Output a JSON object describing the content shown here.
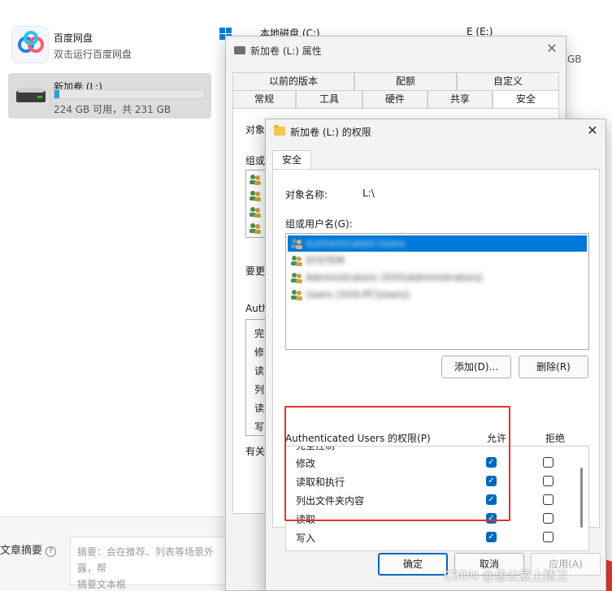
{
  "explorer": {
    "baidu": {
      "name": "百度网盘",
      "subtitle": "双击运行百度网盘"
    },
    "drive_l": {
      "name": "新加卷 (L:)",
      "space": "224 GB 可用，共 231 GB",
      "usage_fraction": 0.03
    },
    "drive_c": {
      "name": "本地磁盘 (C:)"
    },
    "drive_e": {
      "name": "E (E:)",
      "gb_partial": "GB"
    },
    "summary": {
      "label": "文章摘要",
      "help": "?",
      "placeholder_lines": [
        "摘要：会在推荐、列表等场景外露，帮",
        "摘要文本框"
      ]
    }
  },
  "properties_dialog": {
    "title": "新加卷 (L:) 属性",
    "tabs_row1": [
      "以前的版本",
      "配额",
      "自定义"
    ],
    "tabs_row2": [
      "常规",
      "工具",
      "硬件",
      "共享",
      "安全"
    ],
    "active_tab": "安全",
    "side_labels": [
      "对象:",
      "组或",
      "要更",
      "Auth",
      "完",
      "修",
      "读",
      "列",
      "读",
      "写",
      "有关"
    ]
  },
  "permissions_dialog": {
    "title": "新加卷 (L:) 的权限",
    "tab": "安全",
    "object_name_label": "对象名称:",
    "object_name_value": "L:\\",
    "group_label": "组或用户名(G):",
    "users": [
      {
        "name": "Authenticated Users",
        "selected": true
      },
      {
        "name": "SYSTEM",
        "selected": false
      },
      {
        "name": "Administrators (XXX\\Administrators)",
        "selected": false
      },
      {
        "name": "Users (XXX-PC\\Users)",
        "selected": false
      }
    ],
    "add_button": "添加(D)...",
    "remove_button": "删除(R)",
    "perm_header": "Authenticated Users 的权限(P)",
    "allow_header": "允许",
    "deny_header": "拒绝",
    "partial_row": "完全控制",
    "permissions": [
      {
        "name": "修改",
        "allow": true,
        "deny": false
      },
      {
        "name": "读取和执行",
        "allow": true,
        "deny": false
      },
      {
        "name": "列出文件夹内容",
        "allow": true,
        "deny": false
      },
      {
        "name": "读取",
        "allow": true,
        "deny": false
      },
      {
        "name": "写入",
        "allow": true,
        "deny": false
      }
    ],
    "ok_button": "确定",
    "cancel_button": "取消",
    "apply_button": "应用(A)"
  },
  "watermark": "CSDN @愚公爱上精卫",
  "colors": {
    "accent": "#0078d7",
    "highlight": "#e0342a",
    "checkbox": "#0067c0"
  }
}
